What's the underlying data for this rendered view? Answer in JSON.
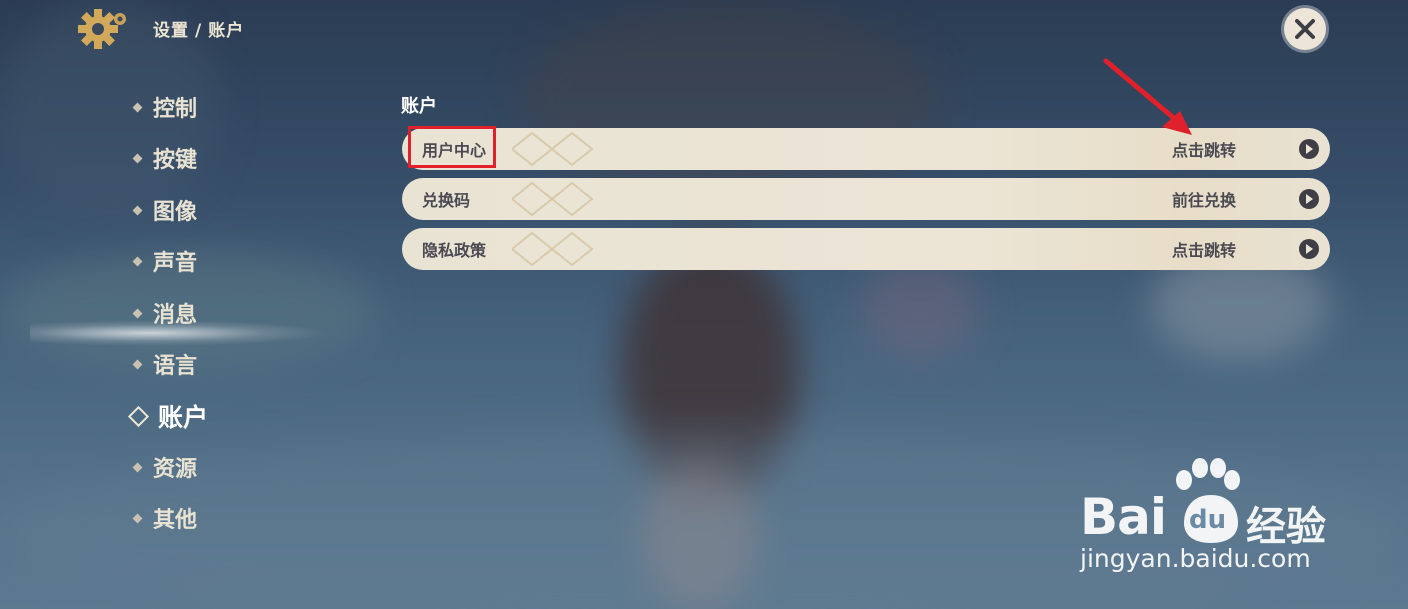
{
  "breadcrumb": {
    "section": "设置",
    "separator": "/",
    "page": "账户"
  },
  "sidebar": {
    "items": [
      {
        "label": "控制"
      },
      {
        "label": "按键"
      },
      {
        "label": "图像"
      },
      {
        "label": "声音"
      },
      {
        "label": "消息"
      },
      {
        "label": "语言"
      },
      {
        "label": "账户",
        "active": true
      },
      {
        "label": "资源"
      },
      {
        "label": "其他"
      }
    ]
  },
  "main": {
    "title": "账户",
    "rows": [
      {
        "label": "用户中心",
        "action": "点击跳转",
        "highlighted": true
      },
      {
        "label": "兑换码",
        "action": "前往兑换"
      },
      {
        "label": "隐私政策",
        "action": "点击跳转"
      }
    ]
  },
  "icons": {
    "settings": "gear-icon",
    "close": "close-icon",
    "row_arrow": "play-arrow-icon"
  },
  "watermark": {
    "brand_left": "Bai",
    "brand_right": "du",
    "product": "经验",
    "url": "jingyan.baidu.com"
  },
  "colors": {
    "highlight": "#e0202a",
    "panel": "#ece5d6",
    "text_dark": "#4b4a52"
  }
}
